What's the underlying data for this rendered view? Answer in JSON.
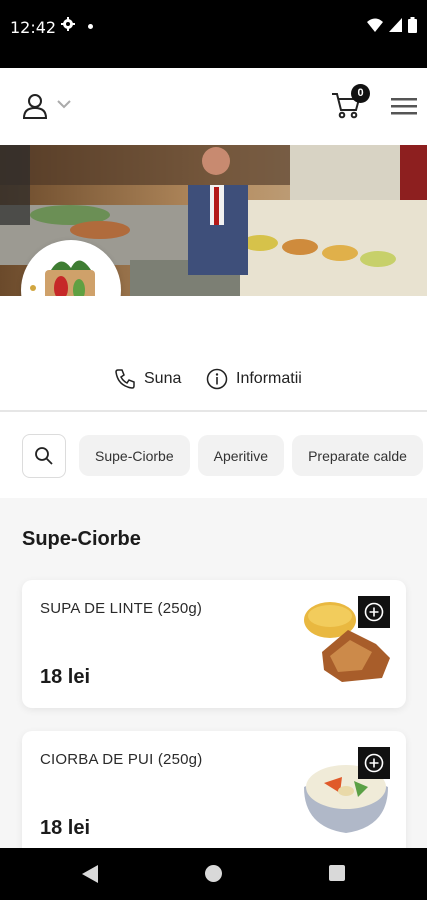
{
  "status_bar": {
    "time": "12:42"
  },
  "header": {
    "cart_count": "0"
  },
  "actions": {
    "call_label": "Suna",
    "info_label": "Informatii"
  },
  "filters": [
    "Supe-Ciorbe",
    "Aperitive",
    "Preparate calde"
  ],
  "section": {
    "title": "Supe-Ciorbe"
  },
  "products": [
    {
      "name": "SUPA DE LINTE (250g)",
      "price": "18 lei"
    },
    {
      "name": "CIORBA DE PUI (250g)",
      "price": "18 lei"
    }
  ],
  "colors": {
    "accent": "#111111",
    "background": "#f6f6f6",
    "card": "#ffffff",
    "chip": "#f2f2f2"
  },
  "icons": [
    "user-icon",
    "chevron-down-icon",
    "cart-icon",
    "menu-icon",
    "phone-icon",
    "info-icon",
    "search-icon",
    "add-icon"
  ]
}
